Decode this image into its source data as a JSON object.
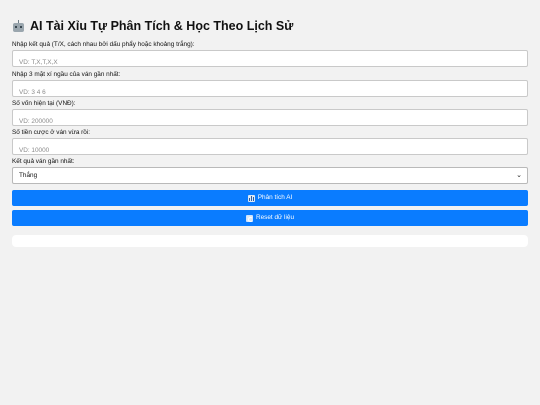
{
  "title": "AI Tài Xỉu Tự Phân Tích & Học Theo Lịch Sử",
  "title_icon": "robot-icon",
  "fields": {
    "results": {
      "label": "Nhập kết quả (T/X, cách nhau bởi dấu phẩy hoặc khoảng trắng):",
      "placeholder": "VD: T,X,T,X,X",
      "value": ""
    },
    "dice": {
      "label": "Nhập 3 mặt xí ngầu của ván gần nhất:",
      "placeholder": "VD: 3 4 6",
      "value": ""
    },
    "capital": {
      "label": "Số vốn hiện tại (VNĐ):",
      "placeholder": "VD: 200000",
      "value": ""
    },
    "bet": {
      "label": "Số tiền cược ở ván vừa rồi:",
      "placeholder": "VD: 10000",
      "value": ""
    },
    "last_result": {
      "label": "Kết quả ván gần nhất:",
      "selected": "Thắng"
    }
  },
  "buttons": {
    "analyze": {
      "label": "Phân tích AI",
      "icon": "bar-chart-icon"
    },
    "reset": {
      "label": "Reset dữ liệu",
      "icon": "refresh-icon"
    }
  },
  "colors": {
    "button": "#0a7cff",
    "background": "#f2f2f2"
  }
}
